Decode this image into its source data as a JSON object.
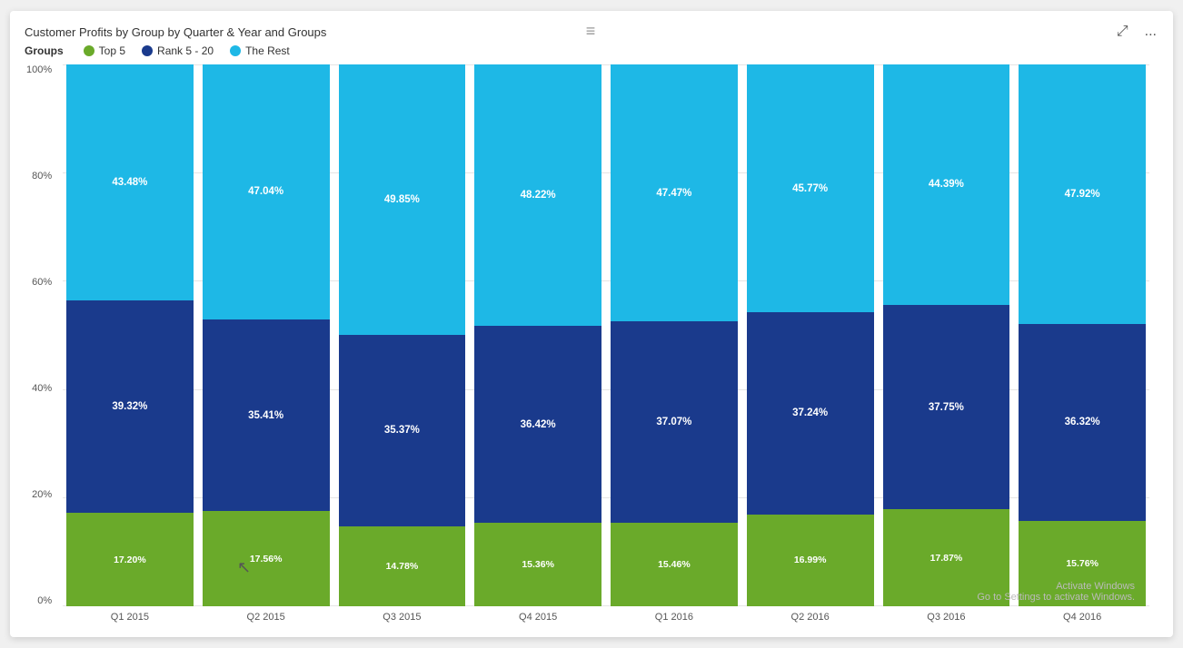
{
  "card": {
    "title": "Customer Profits by Group by Quarter & Year and Groups",
    "drag_handle": "≡",
    "top_buttons": {
      "expand": "⤢",
      "more": "..."
    }
  },
  "legend": {
    "group_label": "Groups",
    "items": [
      {
        "name": "Top 5",
        "color": "#6aaa2a"
      },
      {
        "name": "Rank 5 - 20",
        "color": "#1a3a8c"
      },
      {
        "name": "The Rest",
        "color": "#1eb8e6"
      }
    ]
  },
  "y_axis": {
    "labels": [
      "100%",
      "80%",
      "60%",
      "40%",
      "20%",
      "0%"
    ]
  },
  "colors": {
    "top5": "#6aaa2a",
    "rank5_20": "#1a3a8c",
    "rest": "#1eb8e6"
  },
  "bars": [
    {
      "x_label": "Q1 2015",
      "segments": [
        {
          "pct": 17.2,
          "label": "17.20%",
          "color": "#6aaa2a"
        },
        {
          "pct": 39.32,
          "label": "39.32%",
          "color": "#1a3a8c"
        },
        {
          "pct": 43.48,
          "label": "43.48%",
          "color": "#1eb8e6"
        }
      ]
    },
    {
      "x_label": "Q2 2015",
      "segments": [
        {
          "pct": 17.56,
          "label": "17.56%",
          "color": "#6aaa2a"
        },
        {
          "pct": 35.41,
          "label": "35.41%",
          "color": "#1a3a8c"
        },
        {
          "pct": 47.04,
          "label": "47.04%",
          "color": "#1eb8e6"
        }
      ]
    },
    {
      "x_label": "Q3 2015",
      "segments": [
        {
          "pct": 14.78,
          "label": "14.78%",
          "color": "#6aaa2a"
        },
        {
          "pct": 35.37,
          "label": "35.37%",
          "color": "#1a3a8c"
        },
        {
          "pct": 49.85,
          "label": "49.85%",
          "color": "#1eb8e6"
        }
      ]
    },
    {
      "x_label": "Q4 2015",
      "segments": [
        {
          "pct": 15.36,
          "label": "15.36%",
          "color": "#6aaa2a"
        },
        {
          "pct": 36.42,
          "label": "36.42%",
          "color": "#1a3a8c"
        },
        {
          "pct": 48.22,
          "label": "48.22%",
          "color": "#1eb8e6"
        }
      ]
    },
    {
      "x_label": "Q1 2016",
      "segments": [
        {
          "pct": 15.46,
          "label": "15.46%",
          "color": "#6aaa2a"
        },
        {
          "pct": 37.07,
          "label": "37.07%",
          "color": "#1a3a8c"
        },
        {
          "pct": 47.47,
          "label": "47.47%",
          "color": "#1eb8e6"
        }
      ]
    },
    {
      "x_label": "Q2 2016",
      "segments": [
        {
          "pct": 16.99,
          "label": "16.99%",
          "color": "#6aaa2a"
        },
        {
          "pct": 37.24,
          "label": "37.24%",
          "color": "#1a3a8c"
        },
        {
          "pct": 45.77,
          "label": "45.77%",
          "color": "#1eb8e6"
        }
      ]
    },
    {
      "x_label": "Q3 2016",
      "segments": [
        {
          "pct": 17.87,
          "label": "17.87%",
          "color": "#6aaa2a"
        },
        {
          "pct": 37.75,
          "label": "37.75%",
          "color": "#1a3a8c"
        },
        {
          "pct": 44.39,
          "label": "44.39%",
          "color": "#1eb8e6"
        }
      ]
    },
    {
      "x_label": "Q4 2016",
      "segments": [
        {
          "pct": 15.76,
          "label": "15.76%",
          "color": "#6aaa2a"
        },
        {
          "pct": 36.32,
          "label": "36.32%",
          "color": "#1a3a8c"
        },
        {
          "pct": 47.92,
          "label": "47.92%",
          "color": "#1eb8e6"
        }
      ]
    }
  ],
  "watermark": {
    "line1": "Activate Windows",
    "line2": "Go to Settings to activate Windows."
  }
}
